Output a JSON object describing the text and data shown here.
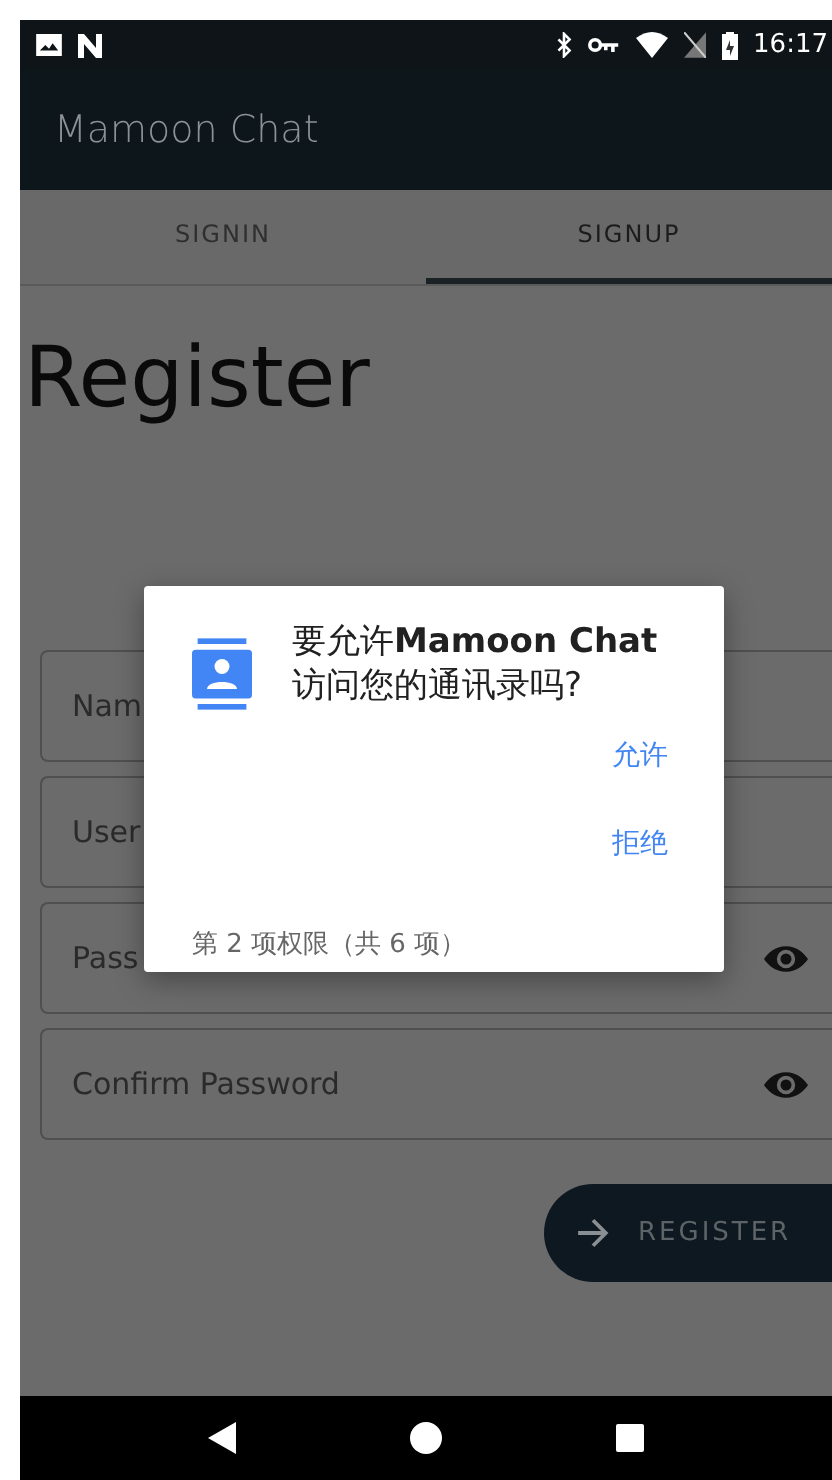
{
  "status_bar": {
    "time": "16:17"
  },
  "app_bar": {
    "title": "Mamoon Chat"
  },
  "tabs": [
    {
      "label": "SIGNIN",
      "selected": false
    },
    {
      "label": "SIGNUP",
      "selected": true
    }
  ],
  "heading": "Register",
  "fields": [
    {
      "placeholder": "Nam",
      "password": false
    },
    {
      "placeholder": "User",
      "password": false
    },
    {
      "placeholder": "Pass",
      "password": true
    },
    {
      "placeholder": "Confirm Password",
      "password": true
    }
  ],
  "register_button": {
    "label": "REGISTER"
  },
  "dialog": {
    "title": "要允许**Mamoon Chat**访问您的通讯录吗?",
    "actions": [
      "允许",
      "拒绝"
    ],
    "footer": "第 2 项权限（共 6 项）"
  }
}
